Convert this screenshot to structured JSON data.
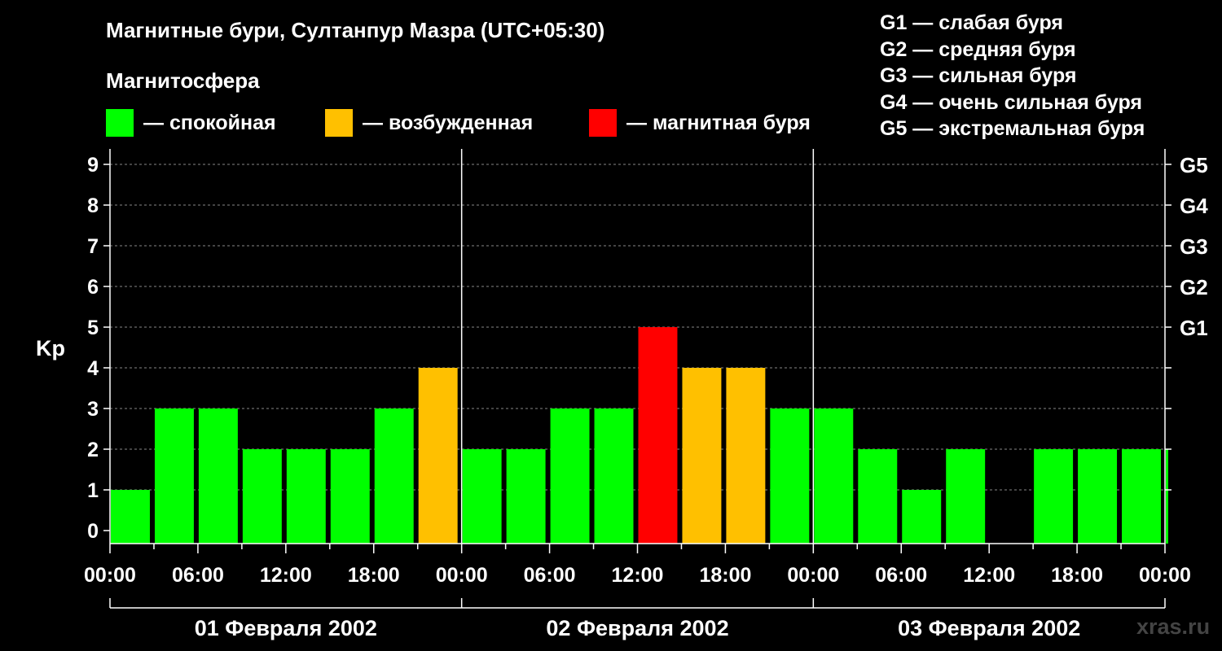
{
  "title": "Магнитные бури, Султанпур Мазра (UTC+05:30)",
  "magnetosphere_label": "Магнитосфера",
  "legend": [
    {
      "label": "— спокойная",
      "color": "#00ff00"
    },
    {
      "label": "— возбужденная",
      "color": "#ffc000"
    },
    {
      "label": "— магнитная буря",
      "color": "#ff0000"
    }
  ],
  "g_legend": [
    "G1 — слабая буря",
    "G2 — средняя буря",
    "G3 — сильная буря",
    "G4 — очень сильная буря",
    "G5 — экстремальная буря"
  ],
  "brand": "xras.ru",
  "chart_data": {
    "type": "bar",
    "ylabel": "Kp",
    "ylim": [
      0,
      9
    ],
    "y_ticks": [
      "0",
      "1",
      "2",
      "3",
      "4",
      "5",
      "6",
      "7",
      "8",
      "9"
    ],
    "right_ticks": [
      {
        "value": 5,
        "label": "G1"
      },
      {
        "value": 6,
        "label": "G2"
      },
      {
        "value": 7,
        "label": "G3"
      },
      {
        "value": 8,
        "label": "G4"
      },
      {
        "value": 9,
        "label": "G5"
      }
    ],
    "x_range_hours": [
      0,
      72
    ],
    "x_tick_labels": [
      "00:00",
      "06:00",
      "12:00",
      "18:00",
      "00:00",
      "06:00",
      "12:00",
      "18:00",
      "00:00",
      "06:00",
      "12:00",
      "18:00",
      "00:00"
    ],
    "dates": [
      "01 Февраля 2002",
      "02 Февраля 2002",
      "03 Февраля 2002"
    ],
    "grid": "dashed horizontal",
    "colors": {
      "quiet": "#00ff00",
      "active": "#ffc000",
      "storm": "#ff0000"
    },
    "bars": [
      {
        "start_hour": 0,
        "end_hour": 3,
        "kp": 1,
        "level": "quiet"
      },
      {
        "start_hour": 3,
        "end_hour": 6,
        "kp": 3,
        "level": "quiet"
      },
      {
        "start_hour": 6,
        "end_hour": 9,
        "kp": 3,
        "level": "quiet"
      },
      {
        "start_hour": 9,
        "end_hour": 12,
        "kp": 2,
        "level": "quiet"
      },
      {
        "start_hour": 12,
        "end_hour": 15,
        "kp": 2,
        "level": "quiet"
      },
      {
        "start_hour": 15,
        "end_hour": 18,
        "kp": 2,
        "level": "quiet"
      },
      {
        "start_hour": 18,
        "end_hour": 21,
        "kp": 3,
        "level": "quiet"
      },
      {
        "start_hour": 21,
        "end_hour": 24,
        "kp": 4,
        "level": "active"
      },
      {
        "start_hour": 24,
        "end_hour": 27,
        "kp": 2,
        "level": "quiet"
      },
      {
        "start_hour": 27,
        "end_hour": 30,
        "kp": 2,
        "level": "quiet"
      },
      {
        "start_hour": 30,
        "end_hour": 33,
        "kp": 3,
        "level": "quiet"
      },
      {
        "start_hour": 33,
        "end_hour": 36,
        "kp": 3,
        "level": "quiet"
      },
      {
        "start_hour": 36,
        "end_hour": 39,
        "kp": 5,
        "level": "storm"
      },
      {
        "start_hour": 39,
        "end_hour": 42,
        "kp": 4,
        "level": "active"
      },
      {
        "start_hour": 42,
        "end_hour": 45,
        "kp": 4,
        "level": "active"
      },
      {
        "start_hour": 45,
        "end_hour": 48,
        "kp": 3,
        "level": "quiet"
      },
      {
        "start_hour": 48,
        "end_hour": 51,
        "kp": 3,
        "level": "quiet"
      },
      {
        "start_hour": 51,
        "end_hour": 54,
        "kp": 2,
        "level": "quiet"
      },
      {
        "start_hour": 54,
        "end_hour": 57,
        "kp": 1,
        "level": "quiet"
      },
      {
        "start_hour": 57,
        "end_hour": 60,
        "kp": 2,
        "level": "quiet"
      },
      {
        "start_hour": 63,
        "end_hour": 66,
        "kp": 2,
        "level": "quiet"
      },
      {
        "start_hour": 66,
        "end_hour": 69,
        "kp": 2,
        "level": "quiet"
      },
      {
        "start_hour": 69,
        "end_hour": 72,
        "kp": 2,
        "level": "quiet"
      },
      {
        "start_hour": 72,
        "end_hour": 72.5,
        "kp": 2,
        "level": "quiet"
      }
    ]
  }
}
